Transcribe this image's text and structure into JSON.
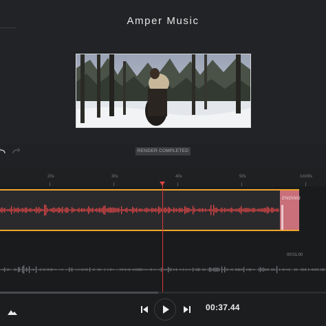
{
  "app": {
    "title": "Amper Music"
  },
  "toolbar": {
    "status_badge": "RENDER COMPLETED"
  },
  "ruler": {
    "ticks": [
      "20s",
      "30s",
      "40s",
      "50s",
      "1m00s"
    ]
  },
  "music_track": {
    "ending_label": "ENDING"
  },
  "video_track": {
    "time_marker": "00:01:00"
  },
  "transport": {
    "timecode": "00:37.44"
  },
  "icons": {
    "undo": "undo-icon",
    "redo": "redo-icon",
    "prev": "skip-back-icon",
    "play": "play-icon",
    "next": "skip-forward-icon",
    "scene": "mountain-icon"
  },
  "colors": {
    "track_border": "#f1a62d",
    "waveform": "#d84545",
    "ending": "#c9707a",
    "playhead": "#d93b3b",
    "background": "#202124"
  }
}
